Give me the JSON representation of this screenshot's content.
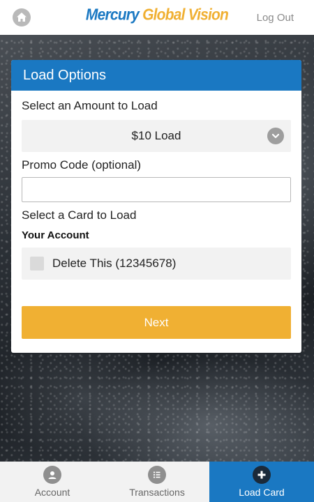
{
  "header": {
    "logo_part1": "Mercury",
    "logo_part2": "Global Vision",
    "logout_label": "Log Out"
  },
  "load_options": {
    "title": "Load Options",
    "amount_label": "Select an Amount to Load",
    "amount_selected": "$10 Load",
    "promo_label": "Promo Code (optional)",
    "promo_value": "",
    "card_label": "Select a Card to Load",
    "account_heading": "Your Account",
    "card_option_label": "Delete This (12345678)",
    "card_option_checked": false,
    "next_label": "Next"
  },
  "bottom_nav": {
    "items": [
      {
        "label": "Account",
        "icon": "user-icon",
        "active": false
      },
      {
        "label": "Transactions",
        "icon": "list-icon",
        "active": false
      },
      {
        "label": "Load Card",
        "icon": "plus-icon",
        "active": true
      }
    ]
  },
  "colors": {
    "brand_blue": "#1a78c2",
    "brand_gold": "#f0b033"
  }
}
